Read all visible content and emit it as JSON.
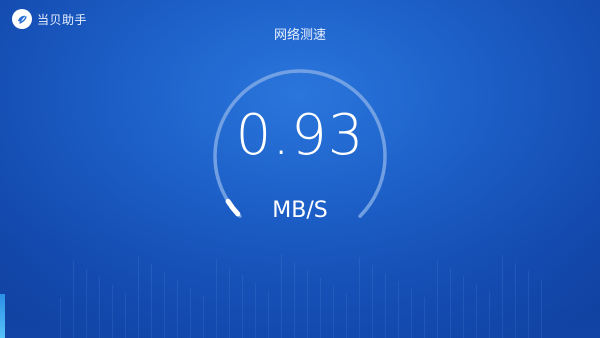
{
  "app": {
    "name": "当贝助手",
    "logo_icon": "dangbei-logo-icon"
  },
  "page": {
    "title": "网络测速"
  },
  "speed": {
    "value": "0.93",
    "unit": "MB/S",
    "gauge_progress": 0.02
  },
  "colors": {
    "background": "#1c5fc7",
    "ring": "#7fa9e6",
    "ring_indicator": "#ffffff",
    "accent": "#56c3f7"
  }
}
